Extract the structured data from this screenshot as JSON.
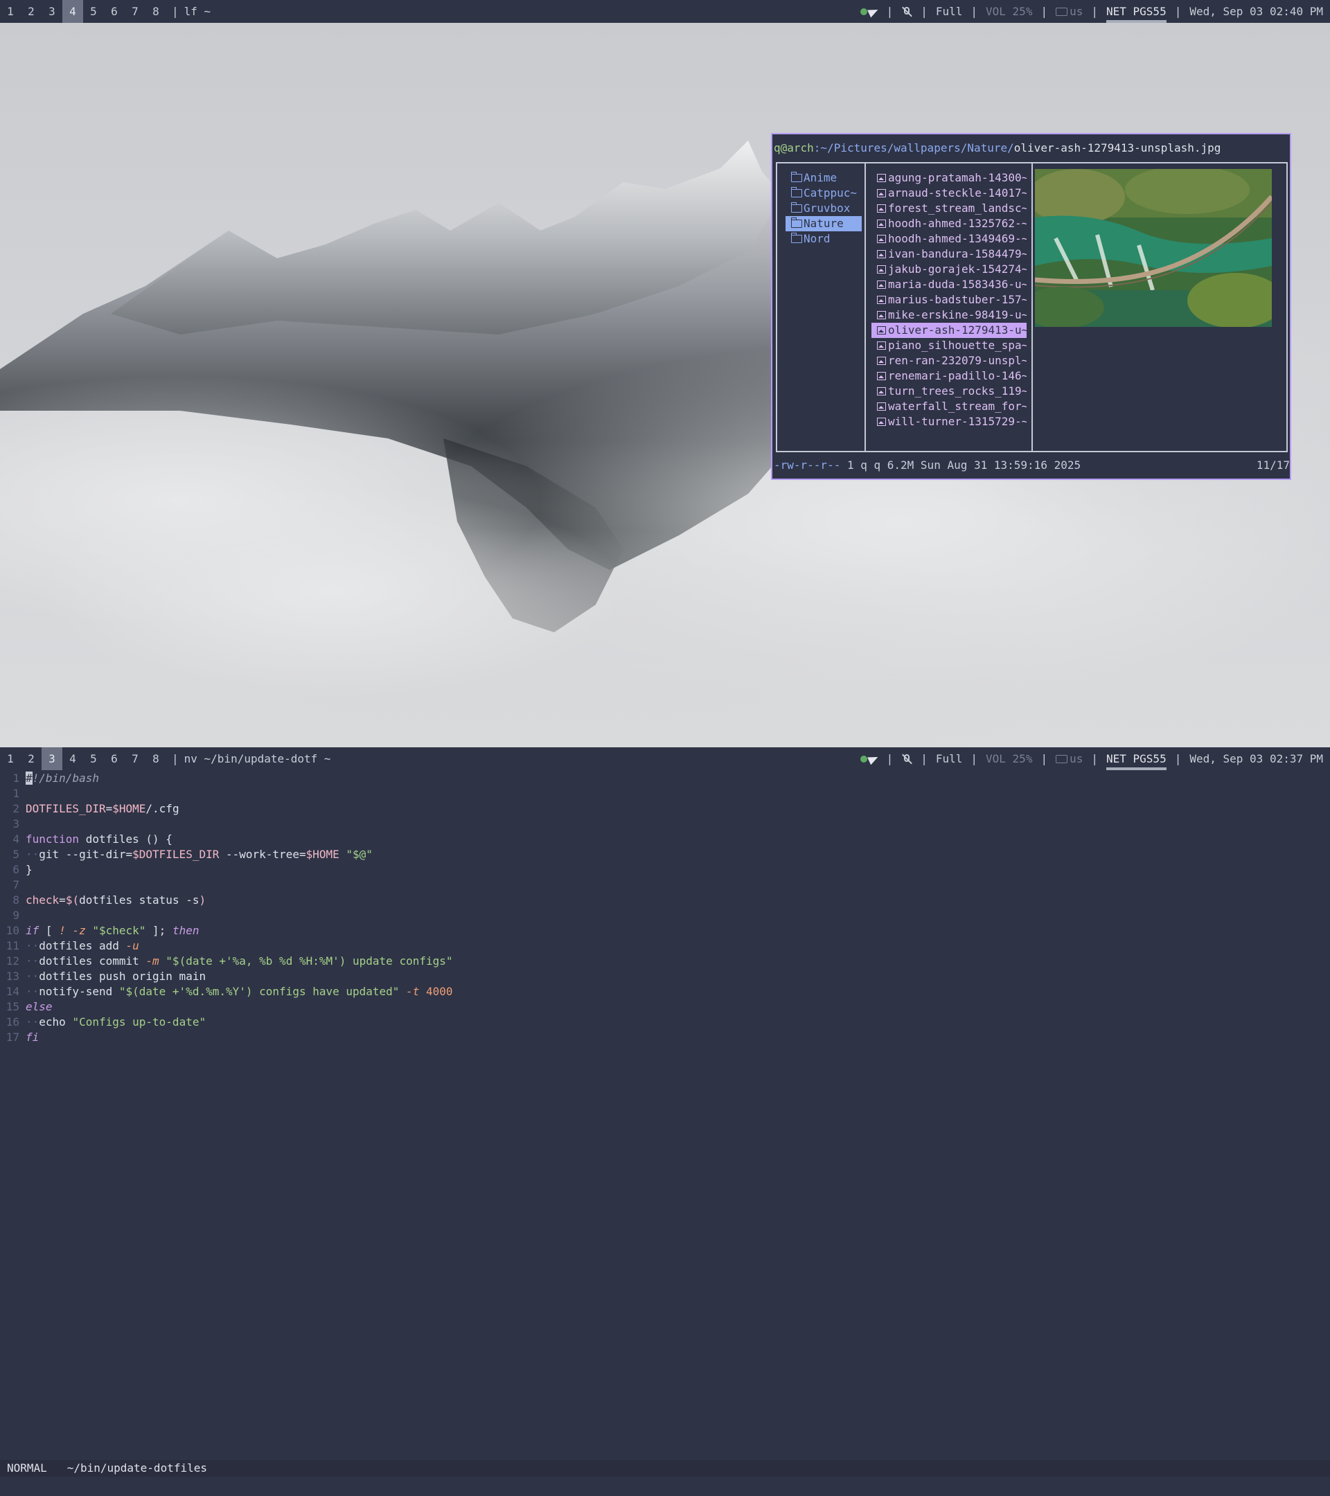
{
  "top_bar": {
    "workspaces": [
      "1",
      "2",
      "3",
      "4",
      "5",
      "6",
      "7",
      "8"
    ],
    "active_workspace": "4",
    "window_title": "lf ~",
    "power": "Full",
    "volume": "VOL 25%",
    "keyboard": "us",
    "network": "NET PGS55",
    "datetime": "Wed, Sep 03 02:40 PM"
  },
  "bottom_bar": {
    "workspaces": [
      "1",
      "2",
      "3",
      "4",
      "5",
      "6",
      "7",
      "8"
    ],
    "active_workspace": "3",
    "window_title": "nv ~/bin/update-dotf ~",
    "power": "Full",
    "volume": "VOL 25%",
    "keyboard": "us",
    "network": "NET PGS55",
    "datetime": "Wed, Sep 03 02:37 PM"
  },
  "lf": {
    "path_user": "q@arch",
    "path_dir": ":~/Pictures/wallpapers/Nature/",
    "path_file": "oliver-ash-1279413-unsplash.jpg",
    "dirs": [
      {
        "name": "Anime",
        "selected": false
      },
      {
        "name": "Catppuc~",
        "selected": false
      },
      {
        "name": "Gruvbox",
        "selected": false
      },
      {
        "name": "Nature",
        "selected": true
      },
      {
        "name": "Nord",
        "selected": false
      }
    ],
    "files": [
      {
        "name": "agung-pratamah-14300~",
        "selected": false
      },
      {
        "name": "arnaud-steckle-14017~",
        "selected": false
      },
      {
        "name": "forest_stream_landsc~",
        "selected": false
      },
      {
        "name": "hoodh-ahmed-1325762-~",
        "selected": false
      },
      {
        "name": "hoodh-ahmed-1349469-~",
        "selected": false
      },
      {
        "name": "ivan-bandura-1584479~",
        "selected": false
      },
      {
        "name": "jakub-gorajek-154274~",
        "selected": false
      },
      {
        "name": "maria-duda-1583436-u~",
        "selected": false
      },
      {
        "name": "marius-badstuber-157~",
        "selected": false
      },
      {
        "name": "mike-erskine-98419-u~",
        "selected": false
      },
      {
        "name": "oliver-ash-1279413-u~",
        "selected": true
      },
      {
        "name": "piano_silhouette_spa~",
        "selected": false
      },
      {
        "name": "ren-ran-232079-unspl~",
        "selected": false
      },
      {
        "name": "renemari-padillo-146~",
        "selected": false
      },
      {
        "name": "turn_trees_rocks_119~",
        "selected": false
      },
      {
        "name": "waterfall_stream_for~",
        "selected": false
      },
      {
        "name": "will-turner-1315729-~",
        "selected": false
      }
    ],
    "status_perm": "-rw-r--r--",
    "status_info": " 1 q q  6.2M Sun Aug 31 13:59:16 2025",
    "status_count": "11/17"
  },
  "editor": {
    "lines": [
      {
        "n": "1",
        "segs": [
          [
            "cursor",
            "#"
          ],
          [
            "comment",
            "!/bin/bash"
          ]
        ]
      },
      {
        "n": "1",
        "segs": []
      },
      {
        "n": "2",
        "segs": [
          [
            "var",
            "DOTFILES_DIR"
          ],
          [
            "plain",
            "="
          ],
          [
            "var",
            "$HOME"
          ],
          [
            "plain",
            "/.cfg"
          ]
        ]
      },
      {
        "n": "3",
        "segs": []
      },
      {
        "n": "4",
        "segs": [
          [
            "kw",
            "function "
          ],
          [
            "plain",
            "dotfiles () {"
          ]
        ]
      },
      {
        "n": "5",
        "segs": [
          [
            "dots",
            "··"
          ],
          [
            "plain",
            "git --git-dir="
          ],
          [
            "var",
            "$DOTFILES_DIR"
          ],
          [
            "plain",
            " --work-tree="
          ],
          [
            "var",
            "$HOME"
          ],
          [
            "plain",
            " "
          ],
          [
            "str",
            "\"$@\""
          ]
        ]
      },
      {
        "n": "6",
        "segs": [
          [
            "plain",
            "}"
          ]
        ]
      },
      {
        "n": "7",
        "segs": []
      },
      {
        "n": "8",
        "segs": [
          [
            "var",
            "check"
          ],
          [
            "plain",
            "="
          ],
          [
            "var",
            "$("
          ],
          [
            "plain",
            "dotfiles status -s"
          ],
          [
            "var",
            ")"
          ]
        ]
      },
      {
        "n": "9",
        "segs": []
      },
      {
        "n": "10",
        "segs": [
          [
            "kwi",
            "if"
          ],
          [
            "plain",
            " [ "
          ],
          [
            "flag",
            "! -z"
          ],
          [
            "plain",
            " "
          ],
          [
            "str",
            "\"$check\""
          ],
          [
            "plain",
            " ]; "
          ],
          [
            "kwi",
            "then"
          ]
        ]
      },
      {
        "n": "11",
        "segs": [
          [
            "dots",
            "··"
          ],
          [
            "plain",
            "dotfiles add "
          ],
          [
            "flag",
            "-u"
          ]
        ]
      },
      {
        "n": "12",
        "segs": [
          [
            "dots",
            "··"
          ],
          [
            "plain",
            "dotfiles commit "
          ],
          [
            "flag",
            "-m"
          ],
          [
            "plain",
            " "
          ],
          [
            "str",
            "\"$(date +'%a, %b %d %H:%M') update configs\""
          ]
        ]
      },
      {
        "n": "13",
        "segs": [
          [
            "dots",
            "··"
          ],
          [
            "plain",
            "dotfiles push origin main"
          ]
        ]
      },
      {
        "n": "14",
        "segs": [
          [
            "dots",
            "··"
          ],
          [
            "plain",
            "notify-send "
          ],
          [
            "str",
            "\"$(date +'%d.%m.%Y') configs have updated\""
          ],
          [
            "plain",
            " "
          ],
          [
            "flag",
            "-t"
          ],
          [
            "plain",
            " "
          ],
          [
            "num",
            "4000"
          ]
        ]
      },
      {
        "n": "15",
        "segs": [
          [
            "kwi",
            "else"
          ]
        ]
      },
      {
        "n": "16",
        "segs": [
          [
            "dots",
            "··"
          ],
          [
            "plain",
            "echo "
          ],
          [
            "str",
            "\"Configs up-to-date\""
          ]
        ]
      },
      {
        "n": "17",
        "segs": [
          [
            "kwi",
            "fi"
          ]
        ]
      }
    ],
    "mode": "NORMAL",
    "filename": "~/bin/update-dotfiles"
  },
  "colors": {
    "background": "#2e3346",
    "accent_purple": "#b49bf5",
    "accent_blue": "#8caaee",
    "green": "#a6d189"
  }
}
